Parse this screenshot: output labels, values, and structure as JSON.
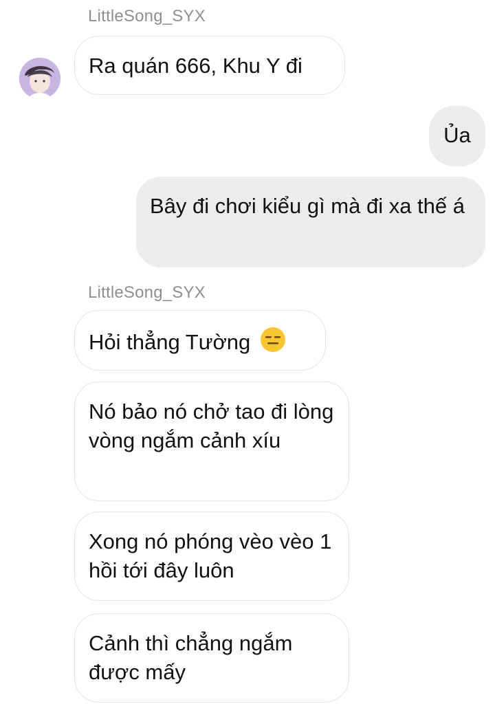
{
  "thread": {
    "sender_name_1": "LittleSong_SYX",
    "sender_name_2": "LittleSong_SYX",
    "messages": [
      {
        "from": "other",
        "text": "Ra quán 666, Khu Y đi"
      },
      {
        "from": "me",
        "text": "Ủa"
      },
      {
        "from": "me",
        "text": "Bây đi chơi kiểu gì mà đi xa thế á"
      },
      {
        "from": "other",
        "text": "Hỏi thẳng Tường",
        "emoji": "expressionless-face"
      },
      {
        "from": "other",
        "text": "Nó bảo nó chở tao đi lòng vòng ngắm cảnh xíu"
      },
      {
        "from": "other",
        "text": "Xong nó phóng vèo vèo 1 hồi tới đây luôn"
      },
      {
        "from": "other",
        "text": "Cảnh thì chẳng ngắm được mấy"
      }
    ]
  },
  "colors": {
    "received_bubble_bg": "#ffffff",
    "received_bubble_border": "#e4e4e6",
    "sent_bubble_bg": "#ececed",
    "text": "#111111",
    "name": "#8e8e93",
    "emoji_face": "#f7c531"
  }
}
